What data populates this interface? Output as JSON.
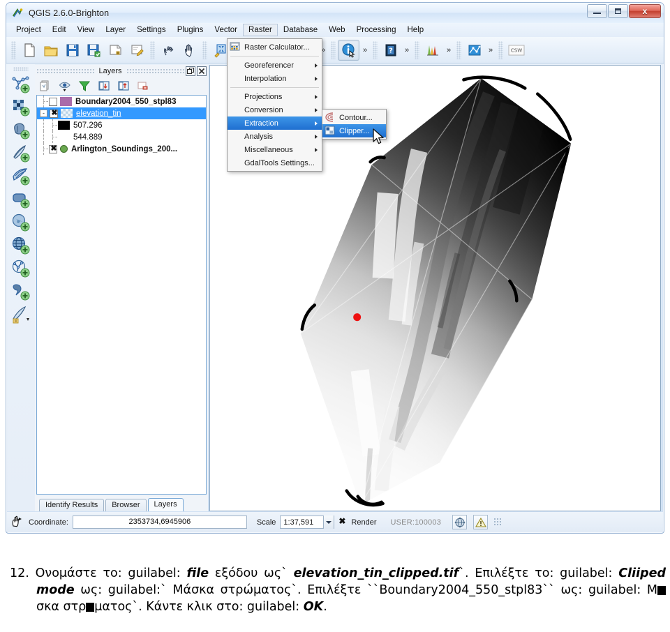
{
  "window": {
    "title": "QGIS 2.6.0-Brighton",
    "app_icon": "qgis-logo-icon",
    "minimize_label": "",
    "maximize_label": "",
    "close_label": "x"
  },
  "menubar": {
    "items": [
      {
        "label": "Project",
        "name": "menu-project",
        "active": false
      },
      {
        "label": "Edit",
        "name": "menu-edit",
        "active": false
      },
      {
        "label": "View",
        "name": "menu-view",
        "active": false
      },
      {
        "label": "Layer",
        "name": "menu-layer",
        "active": false
      },
      {
        "label": "Settings",
        "name": "menu-settings",
        "active": false
      },
      {
        "label": "Plugins",
        "name": "menu-plugins",
        "active": false
      },
      {
        "label": "Vector",
        "name": "menu-vector",
        "active": false
      },
      {
        "label": "Raster",
        "name": "menu-raster",
        "active": true
      },
      {
        "label": "Database",
        "name": "menu-database",
        "active": false
      },
      {
        "label": "Web",
        "name": "menu-web",
        "active": false
      },
      {
        "label": "Processing",
        "name": "menu-processing",
        "active": false
      },
      {
        "label": "Help",
        "name": "menu-help",
        "active": false
      }
    ]
  },
  "raster_menu": {
    "items": [
      {
        "label": "Raster Calculator...",
        "icon": "raster-calculator-icon",
        "submenu": false,
        "highlighted": false
      },
      {
        "label": "Georeferencer",
        "icon": "",
        "submenu": true,
        "highlighted": false
      },
      {
        "label": "Interpolation",
        "icon": "",
        "submenu": true,
        "highlighted": false
      },
      {
        "label": "Projections",
        "icon": "",
        "submenu": true,
        "highlighted": false
      },
      {
        "label": "Conversion",
        "icon": "",
        "submenu": true,
        "highlighted": false
      },
      {
        "label": "Extraction",
        "icon": "",
        "submenu": true,
        "highlighted": true
      },
      {
        "label": "Analysis",
        "icon": "",
        "submenu": true,
        "highlighted": false
      },
      {
        "label": "Miscellaneous",
        "icon": "",
        "submenu": true,
        "highlighted": false
      },
      {
        "label": "GdalTools Settings...",
        "icon": "",
        "submenu": false,
        "highlighted": false
      }
    ]
  },
  "extraction_submenu": {
    "items": [
      {
        "label": "Contour...",
        "icon": "contour-icon",
        "highlighted": false
      },
      {
        "label": "Clipper...",
        "icon": "clipper-icon",
        "highlighted": true
      }
    ]
  },
  "toolbar": {
    "buttons": [
      {
        "name": "new-project-button",
        "icon": "new-document-icon"
      },
      {
        "name": "open-project-button",
        "icon": "open-folder-icon"
      },
      {
        "name": "save-project-button",
        "icon": "save-floppy-icon"
      },
      {
        "name": "save-project-as-button",
        "icon": "save-as-floppy-icon"
      },
      {
        "name": "new-print-composer-button",
        "icon": "new-composer-icon"
      },
      {
        "name": "composer-manager-button",
        "icon": "composer-manager-icon"
      },
      {
        "name": "touch-zoom-button",
        "icon": "touch-hand-icon"
      },
      {
        "name": "pan-map-button",
        "icon": "pan-hand-icon"
      },
      {
        "name": "zoom-full-button",
        "icon": "zoom-full-icon"
      },
      {
        "name": "zoom-in-button",
        "icon": "zoom-in-icon"
      },
      {
        "name": "zoom-out-button",
        "icon": "zoom-out-icon"
      },
      {
        "name": "zoom-last-button",
        "icon": "zoom-last-icon"
      },
      {
        "name": "zoom-next-button",
        "icon": "zoom-next-icon"
      },
      {
        "name": "identify-features-button",
        "icon": "identify-info-icon"
      },
      {
        "name": "help-contents-button",
        "icon": "help-book-icon"
      },
      {
        "name": "statistics-button",
        "icon": "histogram-icon"
      },
      {
        "name": "tin-interpolation-button",
        "icon": "tin-network-icon"
      },
      {
        "name": "csw-button",
        "icon": "csw-icon"
      }
    ],
    "overflow_glyph": "»",
    "csw_label": "CSW"
  },
  "left_toolbar": {
    "buttons": [
      {
        "name": "add-vector-layer-button",
        "icon": "add-vector-layer-icon"
      },
      {
        "name": "add-raster-layer-button",
        "icon": "add-raster-layer-icon"
      },
      {
        "name": "add-postgis-layer-button",
        "icon": "add-postgis-layer-icon"
      },
      {
        "name": "add-spatialite-layer-button",
        "icon": "add-spatialite-layer-icon"
      },
      {
        "name": "add-mssql-layer-button",
        "icon": "add-mssql-layer-icon"
      },
      {
        "name": "add-oracle-layer-button",
        "icon": "add-oracle-layer-icon"
      },
      {
        "name": "add-wms-layer-button",
        "icon": "add-wms-layer-icon"
      },
      {
        "name": "add-wcs-layer-button",
        "icon": "add-wcs-layer-icon"
      },
      {
        "name": "add-wfs-layer-button",
        "icon": "add-wfs-layer-icon"
      },
      {
        "name": "add-delimited-text-layer-button",
        "icon": "add-delimited-text-icon"
      },
      {
        "name": "new-shapefile-layer-button",
        "icon": "new-shapefile-icon"
      }
    ]
  },
  "layers_dock": {
    "title": "Layers",
    "float_button": "undock-icon",
    "close_button": "close-icon",
    "toolbar": [
      {
        "name": "layer-styling-button",
        "icon": "style-manager-icon"
      },
      {
        "name": "manage-visibility-button",
        "icon": "eye-visibility-icon"
      },
      {
        "name": "filter-legend-button",
        "icon": "filter-funnel-icon"
      },
      {
        "name": "expand-all-button",
        "icon": "expand-all-icon"
      },
      {
        "name": "collapse-all-button",
        "icon": "collapse-all-icon"
      },
      {
        "name": "remove-layer-button",
        "icon": "remove-layer-icon"
      }
    ],
    "tree": [
      {
        "name": "layer-boundary2004",
        "label": "Boundary2004_550_stpl83",
        "kind": "vector-polygon",
        "checked": false,
        "bold": true,
        "selected": false,
        "indent": 0,
        "symbol": "polygon-swatch"
      },
      {
        "name": "layer-elevation-tin",
        "label": "elevation_tin",
        "kind": "raster",
        "checked": true,
        "bold": false,
        "selected": true,
        "indent": 0,
        "expander": "-",
        "symbol": "raster-checker-swatch"
      },
      {
        "name": "legend-entry-min",
        "label": "507.296",
        "kind": "legend",
        "checked": null,
        "bold": false,
        "selected": false,
        "indent": 1,
        "symbol": "black-swatch"
      },
      {
        "name": "legend-entry-max",
        "label": "544.889",
        "kind": "legend",
        "checked": null,
        "bold": false,
        "selected": false,
        "indent": 1,
        "symbol": "none"
      },
      {
        "name": "layer-arlington-soundings",
        "label": "Arlington_Soundings_200...",
        "kind": "vector-point",
        "checked": true,
        "bold": true,
        "selected": false,
        "indent": 0,
        "symbol": "point-swatch"
      }
    ]
  },
  "dock_tabs": [
    {
      "label": "Identify Results",
      "name": "tab-identify-results",
      "active": false
    },
    {
      "label": "Browser",
      "name": "tab-browser",
      "active": false
    },
    {
      "label": "Layers",
      "name": "tab-layers",
      "active": true
    }
  ],
  "statusbar": {
    "locator_icon": "coordinate-capture-icon",
    "coordinate_label": "Coordinate:",
    "coordinate_value": "2353734,6945906",
    "scale_label": "Scale",
    "scale_value": "1:37,591",
    "render_label": "Render",
    "render_checked": true,
    "crs_label": "USER:100003",
    "crs_status_icon": "crs-globe-icon",
    "messages_icon": "warning-triangle-icon"
  },
  "map": {
    "layer_name": "elevation_tin",
    "marker": {
      "name": "identify-marker",
      "color": "#ee1111"
    },
    "colors": {
      "raster_dark": "#000000",
      "raster_light": "#ffffff",
      "background": "#ffffff"
    }
  },
  "caption": {
    "number": "12.",
    "line_parts": [
      "Ονομάστε το: guilabel: ",
      "file",
      " εξόδου ως` ",
      "elevation_tin_clipped.tif",
      "`. Επιλέξτε το: guilabel: ",
      "Cliiped mode",
      " ως: guilabel:` Μάσκα στρώματος`. Επιλέξτε ``Boundary2004_550_stpl83`` ως: guilabel: Μ",
      "σκα στρ",
      "ματος`. Κάντε κλικ στο: guilabel: ",
      "OK",
      "."
    ],
    "full_text": "12. Ονομάστε το: guilabel: file εξόδου ως` elevation_tin_clipped.tif`. Επιλέξτε το: guilabel: Cliiped mode ως: guilabel:` Μάσκα στρώματος`. Επιλέξτε ``Boundary2004_550_stpl83`` ως: guilabel: Μ█σκα στρ█ματος`. Κάντε κλικ στο: guilabel: OK."
  }
}
